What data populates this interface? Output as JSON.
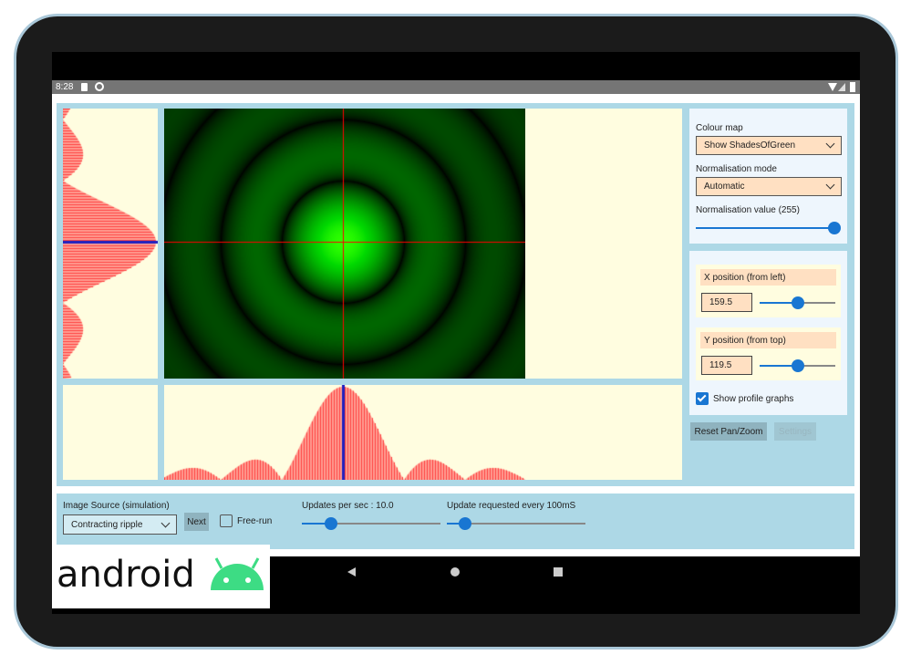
{
  "status_bar": {
    "time": "8:28",
    "icons": [
      "sd-card-icon",
      "sync-icon",
      "wifi-icon",
      "signal-icon",
      "battery-icon"
    ]
  },
  "colour_map": {
    "label": "Colour map",
    "value": "Show ShadesOfGreen"
  },
  "normalisation": {
    "mode_label": "Normalisation mode",
    "mode_value": "Automatic",
    "value_label": "Normalisation value (255)",
    "value": 255,
    "max": 255
  },
  "x_position": {
    "label": "X position (from left)",
    "value": "159.5",
    "fraction": 0.5
  },
  "y_position": {
    "label": "Y position (from top)",
    "value": "119.5",
    "fraction": 0.5
  },
  "show_profiles": {
    "label": "Show profile graphs",
    "checked": true
  },
  "buttons": {
    "reset": "Reset Pan/Zoom",
    "settings": "Settings",
    "next": "Next"
  },
  "image_source": {
    "label": "Image Source (simulation)",
    "value": "Contracting ripple"
  },
  "free_run": {
    "label": "Free-run",
    "checked": false
  },
  "updates": {
    "label": "Updates per sec : 10.0",
    "fraction": 0.21
  },
  "update_requested": {
    "label": "Update requested every 100mS",
    "fraction": 0.13
  },
  "logo": {
    "text": "android"
  },
  "colors": {
    "accent": "#1976d2",
    "panel": "#add8e6",
    "profile": "#ff5050",
    "crosshair": "#ff0000"
  }
}
